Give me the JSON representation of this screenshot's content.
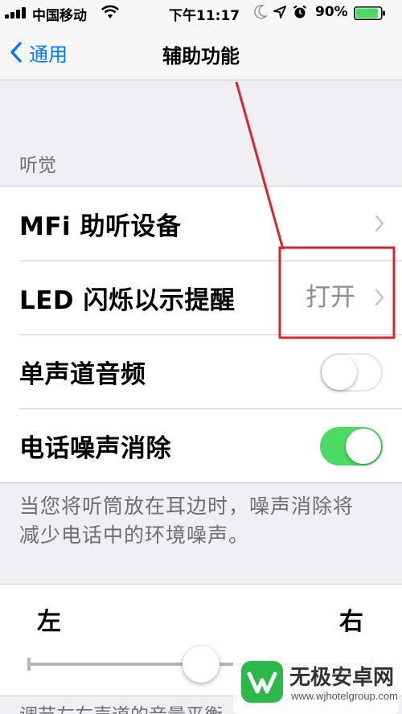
{
  "status_bar": {
    "carrier": "中国移动",
    "time": "下午11:17",
    "battery_percent": "90%",
    "battery_level": 0.9,
    "icons": [
      "signal-icon",
      "wifi-icon",
      "moon-icon",
      "location-icon",
      "alarm-icon",
      "battery-icon"
    ]
  },
  "nav": {
    "back_label": "通用",
    "title": "辅助功能"
  },
  "hearing": {
    "header": "听觉",
    "rows": [
      {
        "label": "MFi 助听设备",
        "detail": "",
        "control": "chevron"
      },
      {
        "label": "LED 闪烁以示提醒",
        "detail": "打开",
        "control": "chevron"
      },
      {
        "label": "单声道音频",
        "control": "toggle",
        "on": false
      },
      {
        "label": "电话噪声消除",
        "control": "toggle",
        "on": true
      }
    ],
    "footer": "当您将听筒放在耳边时，噪声消除将减少电话中的环境噪声。"
  },
  "balance": {
    "left_label": "左",
    "right_label": "右",
    "value": 0.5
  },
  "next_section_header": "调节左右声道的音量平衡",
  "watermark": {
    "title": "无极安卓网",
    "url": "www.wjhotelgroup.com"
  },
  "colors": {
    "accent": "#007aff",
    "toggle_on": "#4cd964",
    "annotation": "#d9262e",
    "background": "#efeff4"
  }
}
